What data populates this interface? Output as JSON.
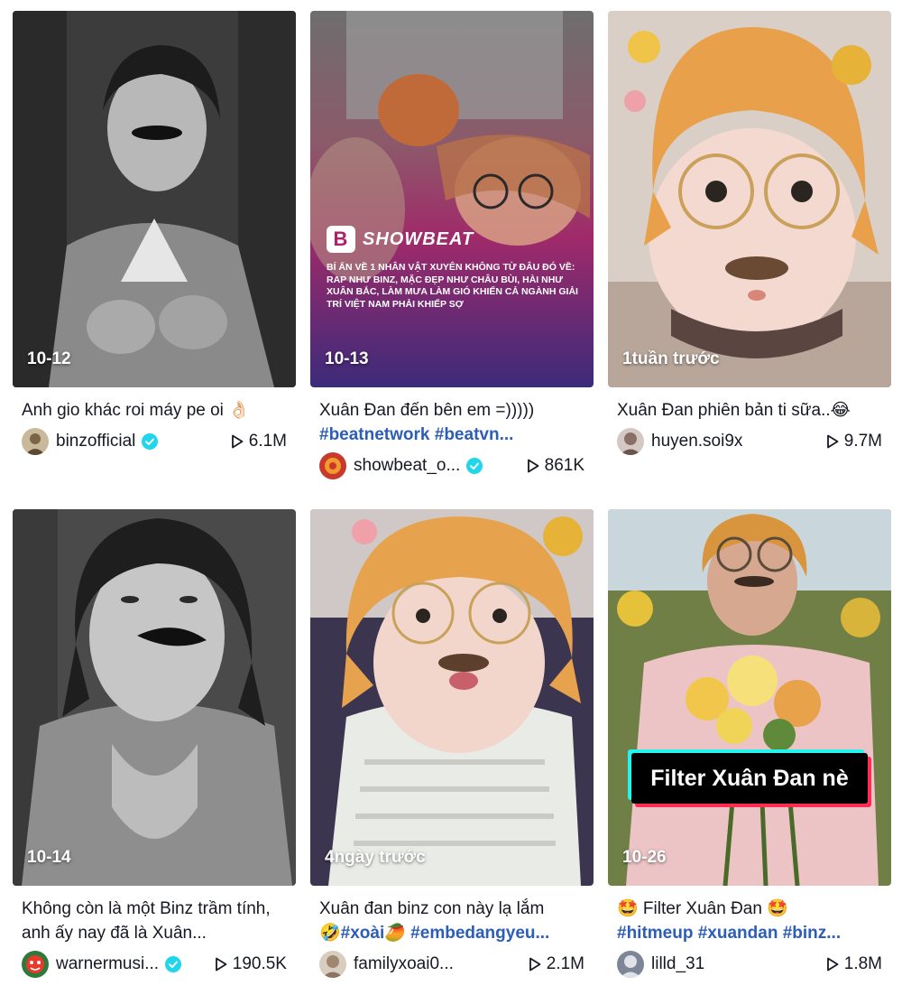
{
  "videos": [
    {
      "date": "10-12",
      "caption": "Anh gio khác roi máy pe oi 👌🏻",
      "caption_tags": "",
      "user": "binzofficial",
      "verified": true,
      "plays": "6.1M"
    },
    {
      "date": "10-13",
      "caption": "Xuân Đan đến bên em =)))))",
      "caption_tags": "#beatnetwork #beatvn...",
      "user": "showbeat_o...",
      "verified": true,
      "plays": "861K",
      "overlay": {
        "brand": "SHOWBEAT",
        "text": "BÍ ẨN VỀ 1 NHÂN VẬT XUYÊN KHÔNG TỪ ĐÂU ĐÓ VỀ: RAP NHƯ BINZ, MẶC ĐẸP NHƯ CHÂU BÙI, HÀI NHƯ XUÂN BẮC, LÀM MƯA LÀM GIÓ KHIẾN CẢ NGÀNH GIẢI TRÍ VIỆT NAM PHẢI KHIẾP SỢ"
      }
    },
    {
      "date": "1tuần trước",
      "caption": "Xuân Đan phiên bản ti sữa..😂",
      "caption_tags": "",
      "user": "huyen.soi9x",
      "verified": false,
      "plays": "9.7M"
    },
    {
      "date": "10-14",
      "caption": "Không còn là một Binz trầm tính, anh ấy nay đã là Xuân...",
      "caption_tags": "",
      "user": "warnermusi...",
      "verified": true,
      "plays": "190.5K"
    },
    {
      "date": "4ngày trước",
      "caption": "Xuân đan binz con này lạ lắm",
      "caption_tags": "🤣#xoài🥭 #embedangyeu...",
      "user": "familyxoai0...",
      "verified": false,
      "plays": "2.1M"
    },
    {
      "date": "10-26",
      "caption": "🤩 Filter Xuân Đan 🤩",
      "caption_tags": "#hitmeup #xuandan #binz...",
      "user": "lilld_31",
      "verified": false,
      "plays": "1.8M",
      "overlay": {
        "banner": "Filter Xuân Đan nè"
      }
    }
  ],
  "colors": {
    "hashtag": "#2b5db9",
    "verified": "#20d5ec",
    "text": "#161823"
  }
}
